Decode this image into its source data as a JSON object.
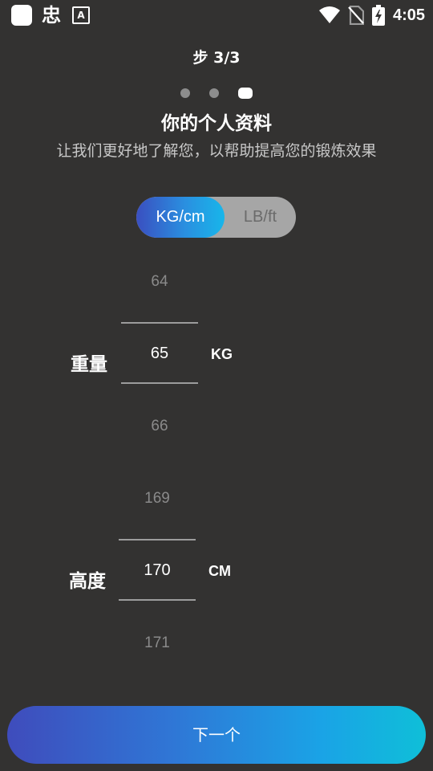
{
  "status_bar": {
    "app_glyph": "忠",
    "a_glyph": "A",
    "time": "4:05",
    "icons": [
      "wifi-icon",
      "no-sim-icon",
      "battery-charging-icon"
    ]
  },
  "header": {
    "step": "步 3/3",
    "total_steps": 3,
    "current_step": 3,
    "title": "你的个人资料",
    "subtitle": "让我们更好地了解您，以帮助提高您的锻炼效果"
  },
  "unit_toggle": {
    "options": [
      "KG/cm",
      "LB/ft"
    ],
    "selected": "KG/cm"
  },
  "weight": {
    "label": "重量",
    "unit": "KG",
    "prev": "64",
    "value": "65",
    "next": "66"
  },
  "height": {
    "label": "高度",
    "unit": "CM",
    "prev": "169",
    "value": "170",
    "next": "171"
  },
  "footer": {
    "next_label": "下一个"
  },
  "colors": {
    "background": "#333231",
    "accent_start": "#3f4cbc",
    "accent_end": "#0fbfd8",
    "toggle_inactive": "#a6a6a6"
  }
}
